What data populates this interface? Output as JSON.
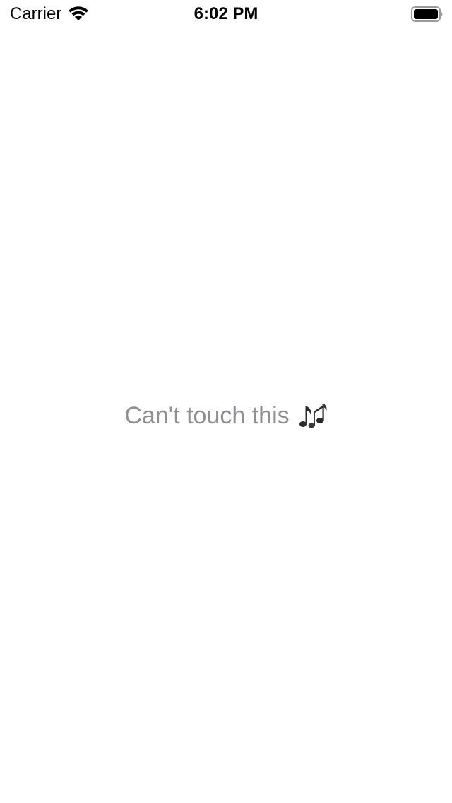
{
  "status_bar": {
    "carrier": "Carrier",
    "time": "6:02 PM",
    "wifi_icon": "wifi-icon",
    "battery_icon": "battery-icon"
  },
  "main": {
    "message": "Can't touch this",
    "emoji_icon": "music-notes-icon",
    "text_color": "#8e8e93"
  }
}
